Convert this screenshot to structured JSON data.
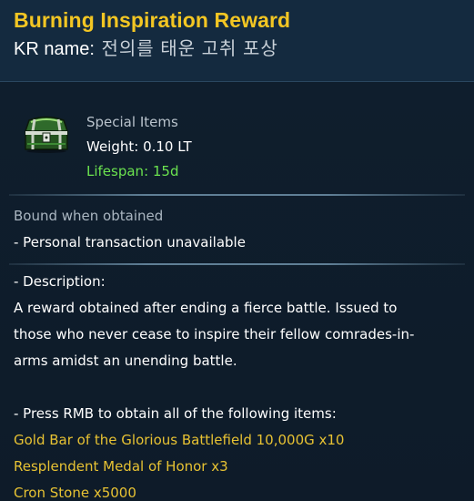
{
  "item": {
    "title": "Burning Inspiration Reward",
    "kr_label": "KR name:",
    "kr_name": "전의를 태운 고취 포상",
    "category": "Special Items",
    "weight": "Weight: 0.10 LT",
    "lifespan": "Lifespan: 15d",
    "icon": "treasure-chest-icon"
  },
  "binding": {
    "bound": "Bound when obtained",
    "transaction": "- Personal transaction unavailable"
  },
  "description": {
    "heading": "- Description:",
    "lines": [
      "A reward obtained after ending a fierce battle. Issued to",
      "those who never cease to inspire their fellow comrades-in-",
      "arms amidst an unending battle."
    ]
  },
  "rewards": {
    "instruction": "- Press RMB to obtain all of the following items:",
    "items": [
      "Gold Bar of the Glorious Battlefield 10,000G x10",
      "Resplendent Medal of Honor x3",
      "Cron Stone x5000"
    ]
  },
  "colors": {
    "title": "#f3c623",
    "lifespan": "#6be24f",
    "reward_item": "#e7c233",
    "background": "#0f1d2c"
  }
}
